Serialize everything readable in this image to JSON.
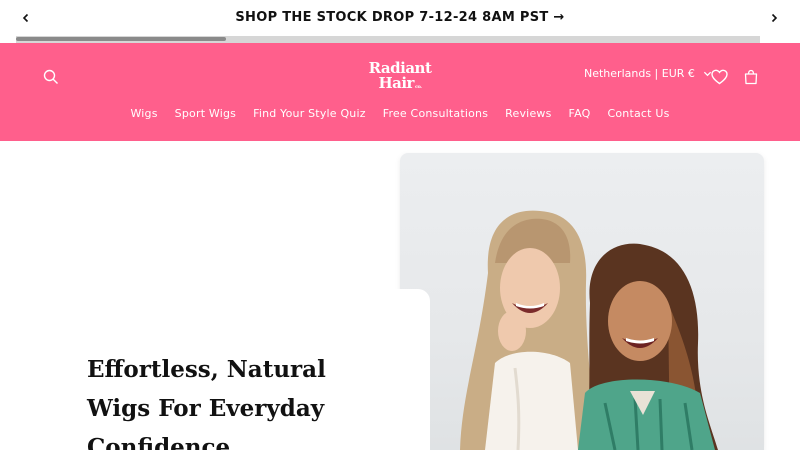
{
  "announcement": {
    "text": "SHOP THE STOCK DROP 7-12-24 8AM PST →"
  },
  "header": {
    "logo_line1": "Radiant",
    "logo_line2": "Hair",
    "logo_co": "co.",
    "country_selector": "Netherlands | EUR €",
    "nav": [
      {
        "label": "Wigs"
      },
      {
        "label": "Sport Wigs"
      },
      {
        "label": "Find Your Style Quiz"
      },
      {
        "label": "Free Consultations"
      },
      {
        "label": "Reviews"
      },
      {
        "label": "FAQ"
      },
      {
        "label": "Contact Us"
      }
    ]
  },
  "hero": {
    "title": "Effortless, Natural Wigs For Everyday Confidence"
  },
  "colors": {
    "brand_pink": "#ff5f8c",
    "text": "#111111"
  },
  "icons": {
    "search": "search-icon",
    "heart": "heart-icon",
    "cart": "cart-icon",
    "prev": "chevron-left-icon",
    "next": "chevron-right-icon",
    "dropdown": "chevron-down-icon"
  }
}
